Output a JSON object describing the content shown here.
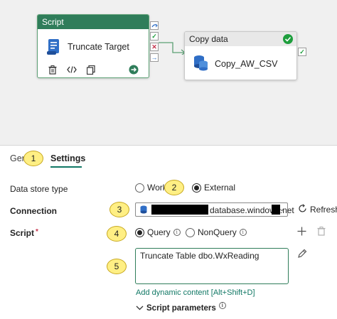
{
  "pipeline": {
    "script_activity": {
      "header": "Script",
      "name": "Truncate Target"
    },
    "copy_activity": {
      "header": "Copy data",
      "name": "Copy_AW_CSV"
    }
  },
  "tabs": [
    {
      "label": "Gen"
    },
    {
      "label": "Settings"
    }
  ],
  "form": {
    "data_store_type": {
      "label": "Data store type",
      "options": [
        "Works",
        "External"
      ],
      "selected": "External"
    },
    "connection": {
      "label": "Connection",
      "value": "database.windows.net",
      "refresh_label": "Refresh"
    },
    "script": {
      "label": "Script",
      "required_marker": "*",
      "options": [
        "Query",
        "NonQuery"
      ],
      "selected": "Query",
      "value": "Truncate Table dbo.WxReading",
      "dynamic_link": "Add dynamic content [Alt+Shift+D]",
      "params_label": "Script parameters"
    }
  },
  "callouts": [
    "1",
    "2",
    "3",
    "4",
    "5"
  ],
  "colors": {
    "accent": "#117865",
    "script_header": "#2f7d5a",
    "success": "#1e9e3d",
    "callout": "#ffef84"
  }
}
